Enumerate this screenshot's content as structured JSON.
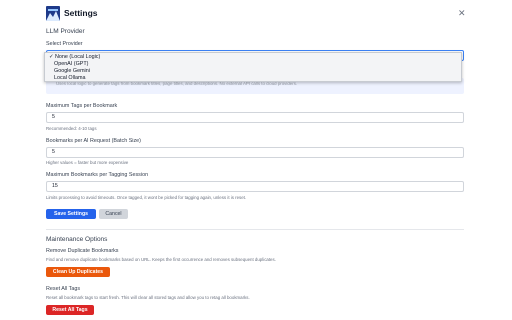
{
  "header": {
    "title": "Settings",
    "close_icon": "close-icon"
  },
  "llm": {
    "section_title": "LLM Provider",
    "provider_label": "Select Provider",
    "options": [
      "None (Local Logic)",
      "OpenAI (GPT)",
      "Google Gemini",
      "Local Ollama"
    ],
    "selected_index": 0,
    "checkmark": "✓",
    "obscured_hint": "Uses local logic to generate tags from bookmark titles, page titles, and descriptions. No external API calls to cloud providers."
  },
  "fields": {
    "max_tags": {
      "label": "Maximum Tags per Bookmark",
      "value": "5",
      "hint": "Recommended: 4-10 tags"
    },
    "batch_size": {
      "label": "Bookmarks per AI Request (Batch Size)",
      "value": "5",
      "hint": "Higher values = faster but more expensive"
    },
    "max_session": {
      "label": "Maximum Bookmarks per Tagging Session",
      "value": "15",
      "hint": "Limits processing to avoid timeouts. Once tagged, it wont be picked for tagging again, unless it is reset."
    }
  },
  "actions": {
    "save_label": "Save Settings",
    "cancel_label": "Cancel"
  },
  "maintenance": {
    "section_title": "Maintenance Options",
    "dup_title": "Remove Duplicate Bookmarks",
    "dup_desc": "Find and remove duplicate bookmarks based on URL. Keeps the first occurrence and removes subsequent duplicates.",
    "dup_button": "Clean Up Duplicates",
    "reset_title": "Reset All Tags",
    "reset_desc": "Reset all bookmark tags to start fresh. This will clear all stored tags and allow you to retag all bookmarks.",
    "reset_button": "Reset All Tags"
  },
  "colors": {
    "primary": "#2563eb",
    "warning": "#ea580c",
    "danger": "#dc2626"
  }
}
